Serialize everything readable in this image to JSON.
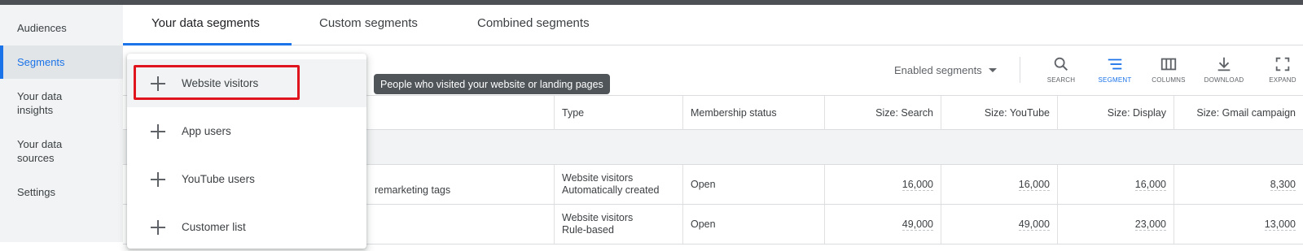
{
  "nav": {
    "audiences": "Audiences",
    "segments": "Segments",
    "data_insights": "Your data insights",
    "data_sources": "Your data sources",
    "settings": "Settings"
  },
  "tabs": [
    {
      "label": "Your data segments",
      "active": true
    },
    {
      "label": "Custom segments",
      "active": false
    },
    {
      "label": "Combined segments",
      "active": false
    }
  ],
  "toolbar": {
    "filter_select": "Enabled segments",
    "buttons": [
      {
        "label": "SEARCH",
        "icon": "search-icon"
      },
      {
        "label": "SEGMENT",
        "icon": "segment-icon",
        "active": true
      },
      {
        "label": "COLUMNS",
        "icon": "columns-icon"
      },
      {
        "label": "DOWNLOAD",
        "icon": "download-icon"
      },
      {
        "label": "EXPAND",
        "icon": "expand-icon"
      }
    ]
  },
  "tooltip": "People who visited your website or landing pages",
  "menu": {
    "items": [
      {
        "label": "Website visitors",
        "icon": "plus-icon"
      },
      {
        "label": "App users",
        "icon": "plus-icon"
      },
      {
        "label": "YouTube users",
        "icon": "plus-icon"
      },
      {
        "label": "Customer list",
        "icon": "plus-icon"
      }
    ]
  },
  "table": {
    "columns": [
      "Type",
      "Membership status",
      "Size: Search",
      "Size: YouTube",
      "Size: Display",
      "Size: Gmail campaign"
    ],
    "rows": [
      {
        "name_fragment": "remarketing tags",
        "type_line1": "Website visitors",
        "type_line2": "Automatically created",
        "status": "Open",
        "size_search": "16,000",
        "size_youtube": "16,000",
        "size_display": "16,000",
        "size_gmail": "8,300"
      },
      {
        "name_fragment": "",
        "type_line1": "Website visitors",
        "type_line2": "Rule-based",
        "status": "Open",
        "size_search": "49,000",
        "size_youtube": "49,000",
        "size_display": "23,000",
        "size_gmail": "13,000"
      }
    ]
  },
  "colors": {
    "accent": "#1a73e8",
    "highlight": "#e0141c",
    "tooltip_bg": "#505559"
  }
}
